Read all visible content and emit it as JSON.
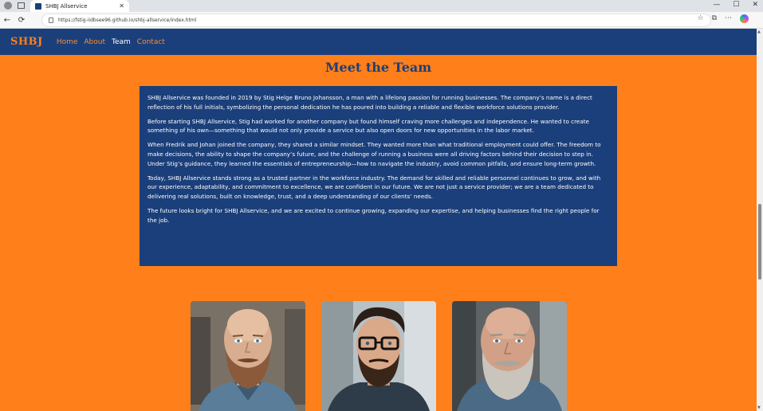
{
  "browser": {
    "tab_title": "SHBJ Allservice",
    "tab_close": "✕",
    "url": "https://fstig-iidbsee96.github.io/shbj-allservice/index.html",
    "nav": {
      "back": "←",
      "reload": "⟳"
    },
    "window_controls": {
      "minimize": "—",
      "maximize": "☐",
      "close": "✕"
    }
  },
  "site": {
    "brand": "SHBJ",
    "nav": [
      {
        "label": "Home",
        "active": false
      },
      {
        "label": "About",
        "active": false
      },
      {
        "label": "Team",
        "active": true
      },
      {
        "label": "Contact",
        "active": false
      }
    ],
    "colors": {
      "accent": "#ff7f1a",
      "primary": "#1b3f7a",
      "text_on_primary": "#ffffff"
    }
  },
  "team_section": {
    "heading": "Meet the Team",
    "paragraphs": [
      "SHBJ Allservice was founded in 2019 by Stig Helge Bruno Johansson, a man with a lifelong passion for running businesses. The company’s name is a direct reflection of his full initials, symbolizing the personal dedication he has poured into building a reliable and flexible workforce solutions provider.",
      "Before starting SHBJ Allservice, Stig had worked for another company but found himself craving more challenges and independence. He wanted to create something of his own—something that would not only provide a service but also open doors for new opportunities in the labor market.",
      "When Fredrik and Johan joined the company, they shared a similar mindset. They wanted more than what traditional employment could offer. The freedom to make decisions, the ability to shape the company’s future, and the challenge of running a business were all driving factors behind their decision to step in. Under Stig’s guidance, they learned the essentials of entrepreneurship—how to navigate the industry, avoid common pitfalls, and ensure long-term growth.",
      "Today, SHBJ Allservice stands strong as a trusted partner in the workforce industry. The demand for skilled and reliable personnel continues to grow, and with our experience, adaptability, and commitment to excellence, we are confident in our future. We are not just a service provider; we are a team dedicated to delivering real solutions, built on knowledge, trust, and a deep understanding of our clients’ needs.",
      "The future looks bright for SHBJ Allservice, and we are excited to continue growing, expanding our expertise, and helping businesses find the right people for the job."
    ],
    "members": [
      {
        "icon": "bald-bearded-man-photo"
      },
      {
        "icon": "man-with-glasses-photo"
      },
      {
        "icon": "older-bearded-man-photo"
      }
    ]
  }
}
